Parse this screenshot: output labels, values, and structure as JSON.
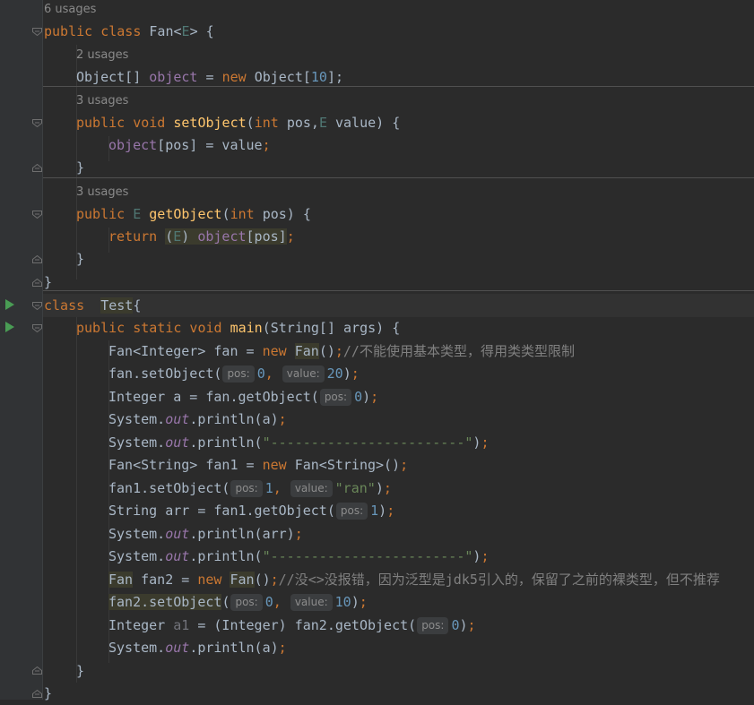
{
  "editor": {
    "usages": {
      "class_fan": "6 usages",
      "object_field": "2 usages",
      "set_object": "3 usages",
      "get_object": "3 usages"
    },
    "code": {
      "class_decl": {
        "kw": "public class ",
        "name": "Fan<",
        "tp": "E",
        "rest": "> {"
      },
      "field": {
        "type": "Object[] ",
        "name": "object",
        "eq": " = ",
        "kw_new": "new ",
        "ctor": "Object[",
        "num": "10",
        "end": "];"
      },
      "set_decl": {
        "kw": "public void ",
        "fn": "setObject",
        "p1": "(",
        "kw_int": "int ",
        "p2": "pos,",
        "tp": "E",
        "p3": " value) {"
      },
      "set_body": {
        "fld": "object",
        "rest": "[pos] = value",
        "semi": ";"
      },
      "close1": "}",
      "get_decl": {
        "kw": "public ",
        "tp": "E",
        "sp": " ",
        "fn": "getObject",
        "p1": "(",
        "kw_int": "int ",
        "p2": "pos) {"
      },
      "get_body": {
        "kw": "return ",
        "cast_open": "(",
        "cast_tp": "E",
        "cast_close": ") ",
        "fld": "object",
        "rest": "[pos]",
        "semi": ";"
      },
      "close2": "}",
      "close_class": "}",
      "test_decl": {
        "kw": "class  ",
        "name": "Test",
        "rest": "{"
      },
      "main_decl": {
        "kw": "public static void ",
        "fn": "main",
        "rest": "(String[] args) {"
      },
      "l1": {
        "a": "Fan<Integer> fan = ",
        "kw": "new ",
        "b": "Fan",
        "c": "()",
        "semi": ";",
        "cmt": "//不能使用基本类型，得用类类型限制"
      },
      "l2": {
        "a": "fan.setObject(",
        "h1": "pos:",
        "n1": "0",
        "comma": ", ",
        "h2": "value:",
        "n2": "20",
        "end": ")",
        "semi": ";"
      },
      "l3": {
        "a": "Integer a = fan.getObject(",
        "h1": "pos:",
        "n1": "0",
        "end": ")",
        "semi": ";"
      },
      "l4": {
        "a": "System.",
        "out": "out",
        "b": ".println(a)",
        "semi": ";"
      },
      "l5": {
        "a": "System.",
        "out": "out",
        "b": ".println(",
        "str": "\"------------------------\"",
        "end": ")",
        "semi": ";"
      },
      "l6": {
        "a": "Fan<String> fan1 = ",
        "kw": "new ",
        "b": "Fan<String>()",
        "semi": ";"
      },
      "l7": {
        "a": "fan1.setObject(",
        "h1": "pos:",
        "n1": "1",
        "comma": ", ",
        "h2": "value:",
        "str": "\"ran\"",
        "end": ")",
        "semi": ";"
      },
      "l8": {
        "a": "String arr = fan1.getObject(",
        "h1": "pos:",
        "n1": "1",
        "end": ")",
        "semi": ";"
      },
      "l9": {
        "a": "System.",
        "out": "out",
        "b": ".println(arr)",
        "semi": ";"
      },
      "l10": {
        "a": "System.",
        "out": "out",
        "b": ".println(",
        "str": "\"------------------------\"",
        "end": ")",
        "semi": ";"
      },
      "l11": {
        "a": "Fan",
        "b": " fan2 = ",
        "kw": "new ",
        "c": "Fan",
        "d": "()",
        "semi": ";",
        "cmt": "//没<>没报错，因为泛型是jdk5引入的，保留了之前的裸类型，但不推荐"
      },
      "l12": {
        "a": "fan2.setObject",
        "b": "(",
        "h1": "pos:",
        "n1": "0",
        "comma": ", ",
        "h2": "value:",
        "n2": "10",
        "end": ")",
        "semi": ";"
      },
      "l13": {
        "a": "Integer ",
        "grey": "a1",
        "b": " = (Integer) fan2.getObject(",
        "h1": "pos:",
        "n1": "0",
        "end": ")",
        "semi": ";"
      },
      "l14": {
        "a": "System.",
        "out": "out",
        "b": ".println(a)",
        "semi": ";"
      },
      "close_main": "}",
      "close_test": "}"
    }
  },
  "colors": {
    "background": "#2b2b2b",
    "gutter": "#313335",
    "keyword": "#cc7832",
    "method": "#ffc66d",
    "field": "#9876aa",
    "number": "#6897bb",
    "string": "#6a8759",
    "comment": "#808080",
    "run_icon": "#499c54"
  }
}
